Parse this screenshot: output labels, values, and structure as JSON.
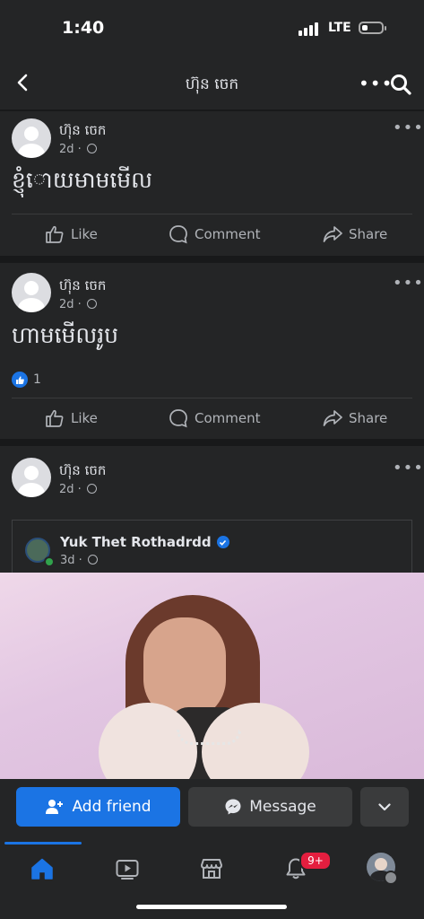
{
  "status": {
    "time": "1:40",
    "network": "LTE"
  },
  "header": {
    "title": "ហ៊ុន ចេក"
  },
  "posts": [
    {
      "author": "ហ៊ុន ចេក",
      "time": "2d ·",
      "text": "ខ្ញុំោយមាមមើល",
      "reactions": null
    },
    {
      "author": "ហ៊ុន ចេក",
      "time": "2d ·",
      "text": "ហាមមើលរូប",
      "reactions": "1"
    },
    {
      "author": "ហ៊ុន ចេក",
      "time": "2d ·",
      "shared": {
        "author": "Yuk Thet Rothadrdd",
        "time": "3d ·"
      }
    }
  ],
  "actions": {
    "like": "Like",
    "comment": "Comment",
    "share": "Share"
  },
  "buttons": {
    "add_friend": "Add friend",
    "message": "Message"
  },
  "tabs": {
    "notifications_badge": "9+"
  },
  "colors": {
    "accent": "#1b74e4",
    "background": "#18191a",
    "surface": "#242526",
    "badge": "#e41e3f"
  }
}
